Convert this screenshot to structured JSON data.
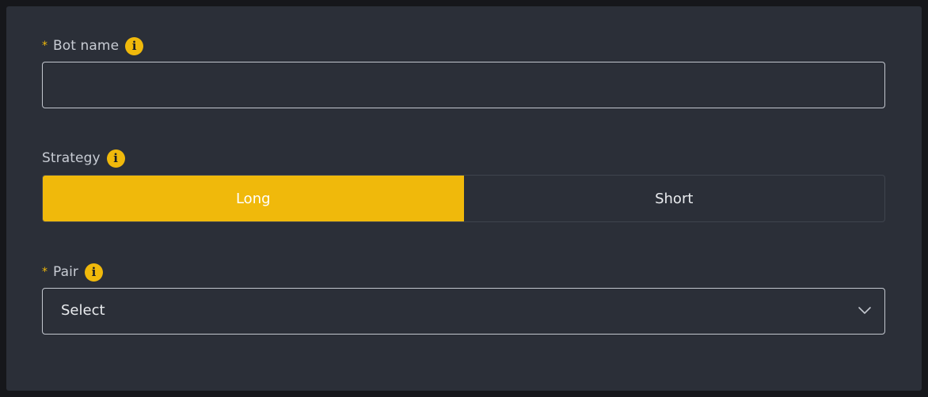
{
  "form": {
    "bot_name": {
      "required_mark": "*",
      "label": "Bot name",
      "value": ""
    },
    "strategy": {
      "label": "Strategy",
      "options": [
        {
          "label": "Long",
          "selected": true
        },
        {
          "label": "Short",
          "selected": false
        }
      ]
    },
    "pair": {
      "required_mark": "*",
      "label": "Pair",
      "selected_value": "Select"
    }
  },
  "icons": {
    "info": "info-icon",
    "dropdown": "chevron-down-icon"
  },
  "colors": {
    "accent": "#f0b90b",
    "panel_background": "#2b2f38",
    "page_background": "#16171b"
  }
}
